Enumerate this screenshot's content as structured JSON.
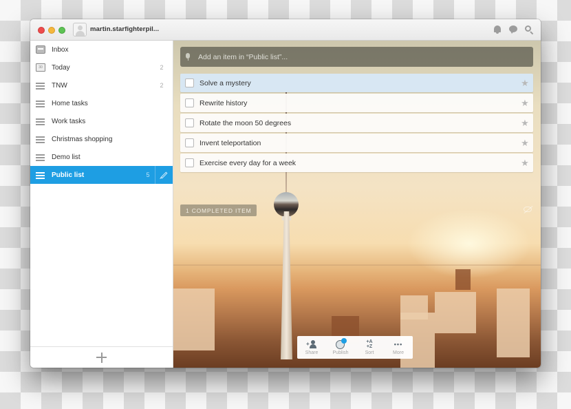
{
  "window": {
    "username": "martin.starfighterpil...",
    "titlebar_icons": [
      "bell-icon",
      "chat-bubble-icon",
      "search-icon"
    ]
  },
  "sidebar": {
    "items": [
      {
        "label": "Inbox",
        "icon": "inbox-icon",
        "count": ""
      },
      {
        "label": "Today",
        "icon": "calendar-icon",
        "count": "2",
        "calendar_day": "30"
      },
      {
        "label": "TNW",
        "icon": "list-icon",
        "count": "2"
      },
      {
        "label": "Home tasks",
        "icon": "list-icon",
        "count": ""
      },
      {
        "label": "Work tasks",
        "icon": "list-icon",
        "count": ""
      },
      {
        "label": "Christmas shopping",
        "icon": "list-icon",
        "count": ""
      },
      {
        "label": "Demo list",
        "icon": "list-icon",
        "count": ""
      },
      {
        "label": "Public list",
        "icon": "list-icon",
        "count": "5",
        "active": true
      }
    ],
    "add_list_icon": "plus-icon"
  },
  "main": {
    "add_item_placeholder": "Add an item in “Public list”...",
    "tasks": [
      {
        "title": "Solve a mystery",
        "selected": true,
        "starred": false
      },
      {
        "title": "Rewrite history",
        "selected": false,
        "starred": false
      },
      {
        "title": "Rotate the moon 50 degrees",
        "selected": false,
        "starred": false
      },
      {
        "title": "Invent teleportation",
        "selected": false,
        "starred": false
      },
      {
        "title": "Exercise every day for a week",
        "selected": false,
        "starred": false
      }
    ],
    "completed_label": "1 COMPLETED ITEM",
    "toolbar": [
      {
        "label": "Share",
        "icon": "share-user-icon"
      },
      {
        "label": "Publish",
        "icon": "globe-icon"
      },
      {
        "label": "Sort",
        "icon": "sort-az-icon"
      },
      {
        "label": "More",
        "icon": "more-dots-icon"
      }
    ]
  },
  "colors": {
    "accent": "#1e9ee3",
    "close": "#ee4c4c",
    "minimize": "#f5b73c",
    "maximize": "#5ec354"
  }
}
